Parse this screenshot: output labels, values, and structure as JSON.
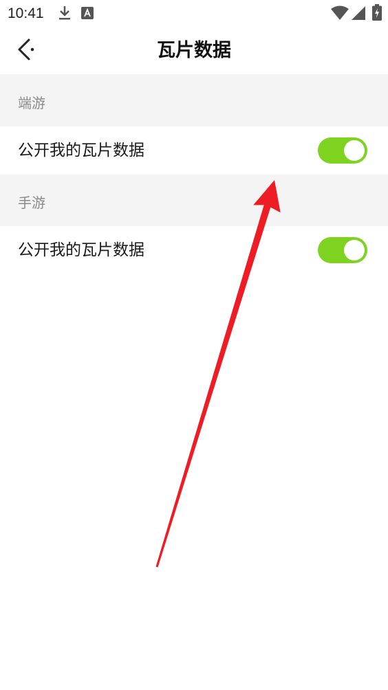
{
  "status_bar": {
    "time": "10:41",
    "icons": [
      "download-icon",
      "a-notification-icon",
      "wifi-icon",
      "signal-icon",
      "battery-charging-icon"
    ]
  },
  "toolbar": {
    "title": "瓦片数据",
    "back_icon": "chevron-left-icon"
  },
  "sections": [
    {
      "header": "端游",
      "rows": [
        {
          "label": "公开我的瓦片数据",
          "toggle_on": true
        }
      ]
    },
    {
      "header": "手游",
      "rows": [
        {
          "label": "公开我的瓦片数据",
          "toggle_on": true
        }
      ]
    }
  ],
  "colors": {
    "accent": "#7ed321",
    "section_bg": "#f4f4f4",
    "annotation_arrow": "#ee1c25"
  }
}
